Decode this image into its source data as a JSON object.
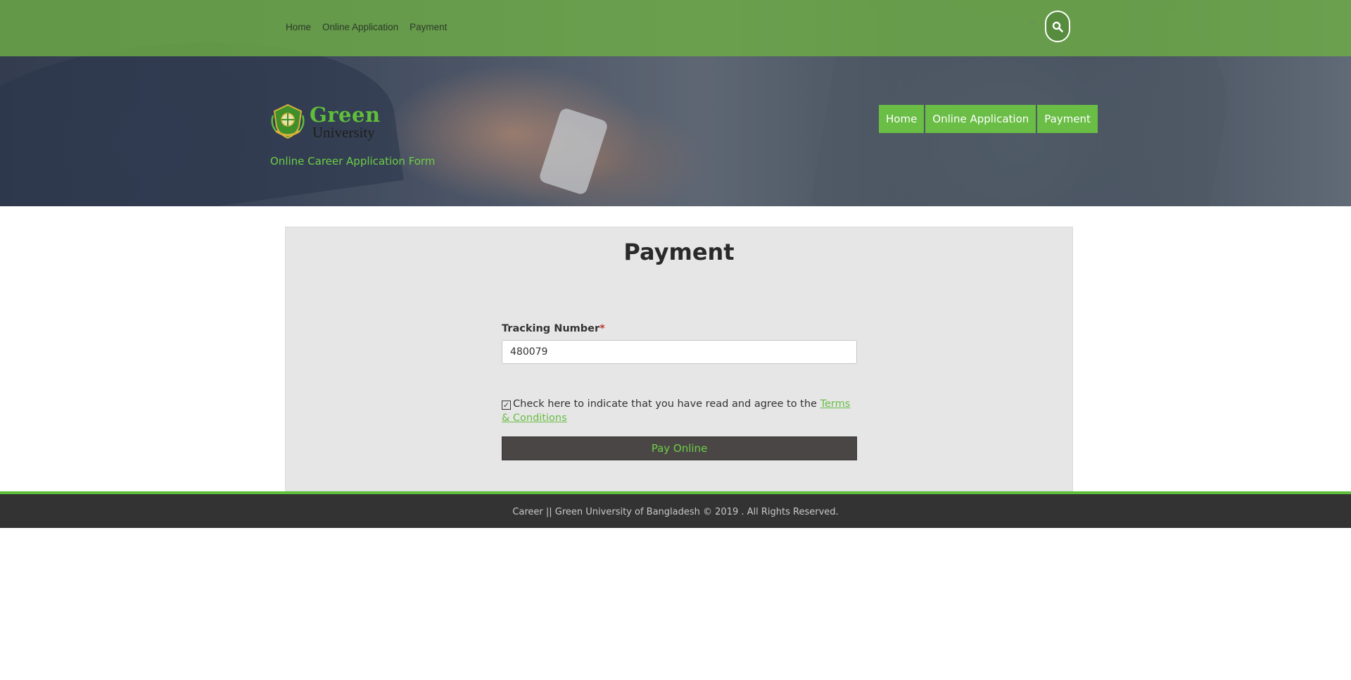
{
  "top_nav": [
    "Home",
    "Online Application",
    "Payment"
  ],
  "header": {
    "logo": {
      "word1": "Green",
      "word2": "University"
    },
    "tagline": "Online Career Application Form"
  },
  "main_nav": [
    "Home",
    "Online Application",
    "Payment"
  ],
  "payment": {
    "title": "Payment",
    "tracking_label": "Tracking Number",
    "required_mark": "*",
    "tracking_value": "480079",
    "terms_checked": true,
    "terms_text": "Check here to indicate that you have read and agree to the",
    "terms_link": "Terms & Conditions",
    "pay_button": "Pay Online"
  },
  "footer": {
    "text": "Career || Green University of Bangladesh © 2019 . All Rights Reserved."
  },
  "colors": {
    "brand_green": "#6abd45",
    "topbar_green": "#6cac46",
    "footer_dark": "#333333",
    "button_dark": "#4a4646"
  },
  "icons": [
    "search-icon",
    "university-crest-icon",
    "checkbox-checked-icon"
  ]
}
